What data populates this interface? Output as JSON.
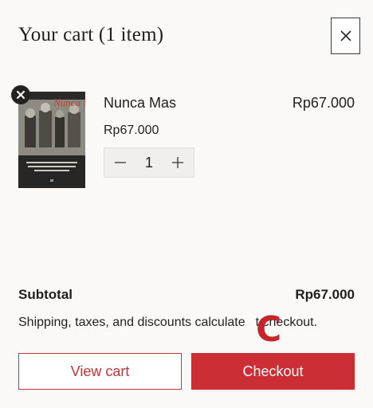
{
  "header": {
    "title": "Your cart (1 item)",
    "close_icon": "close-icon"
  },
  "cart_item": {
    "name": "Nunca Mas",
    "unit_price": "Rp67.000",
    "line_price": "Rp67.000",
    "quantity": "1",
    "cover_art_text": "Nunca Mas",
    "remove_icon": "close-icon"
  },
  "summary": {
    "subtotal_label": "Subtotal",
    "subtotal_value": "Rp67.000",
    "note_before": "Shipping, taxes, and discounts calculate",
    "note_after": "t checkout.",
    "overlay_mark": "C"
  },
  "actions": {
    "view_cart_label": "View cart",
    "checkout_label": "Checkout"
  },
  "colors": {
    "accent": "#cb2f35",
    "background": "#faf9f8",
    "text": "#1f1f1f"
  }
}
